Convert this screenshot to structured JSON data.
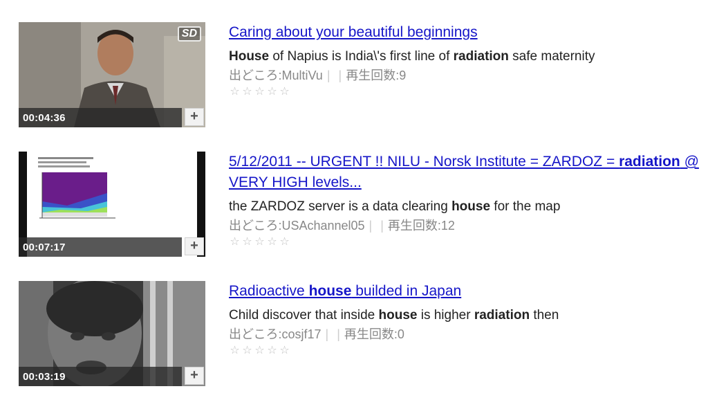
{
  "results": [
    {
      "duration": "00:04:36",
      "badge": "SD",
      "add_icon": "+",
      "title_parts": [
        {
          "text": "Caring about your beautiful beginnings",
          "bold": false
        }
      ],
      "desc_parts": [
        {
          "text": "House",
          "bold": true
        },
        {
          "text": " of Napius is India\\'s first line of ",
          "bold": false
        },
        {
          "text": "radiation",
          "bold": true
        },
        {
          "text": " safe maternity",
          "bold": false
        }
      ],
      "source_label": "出どころ:MultiVu",
      "sep1": "|",
      "sep2": "|",
      "views_label": "再生回数:9",
      "rating": 0
    },
    {
      "duration": "00:07:17",
      "badge": "",
      "add_icon": "+",
      "title_parts": [
        {
          "text": "5/12/2011 -- URGENT !! NILU - Norsk Institute = ZARDOZ = ",
          "bold": false
        },
        {
          "text": "radiation",
          "bold": true
        },
        {
          "text": " @ VERY HIGH levels...",
          "bold": false
        }
      ],
      "desc_parts": [
        {
          "text": "the ZARDOZ server is a data clearing ",
          "bold": false
        },
        {
          "text": "house",
          "bold": true
        },
        {
          "text": " for the map",
          "bold": false
        }
      ],
      "source_label": "出どころ:USAchannel05",
      "sep1": "|",
      "sep2": "|",
      "views_label": "再生回数:12",
      "rating": 0
    },
    {
      "duration": "00:03:19",
      "badge": "",
      "add_icon": "+",
      "title_parts": [
        {
          "text": "Radioactive ",
          "bold": false
        },
        {
          "text": "house",
          "bold": true
        },
        {
          "text": " builded in Japan",
          "bold": false
        }
      ],
      "desc_parts": [
        {
          "text": "Child discover that inside ",
          "bold": false
        },
        {
          "text": "house",
          "bold": true
        },
        {
          "text": " is higher ",
          "bold": false
        },
        {
          "text": "radiation",
          "bold": true
        },
        {
          "text": " then",
          "bold": false
        }
      ],
      "source_label": "出どころ:cosjf17",
      "sep1": "|",
      "sep2": "|",
      "views_label": "再生回数:0",
      "rating": 0
    }
  ],
  "star_icon": "star-outline-icon",
  "star_glyph": "☆",
  "colors": {
    "link": "#1515c8",
    "meta_text": "#888888",
    "duration_bar": "#282828"
  }
}
